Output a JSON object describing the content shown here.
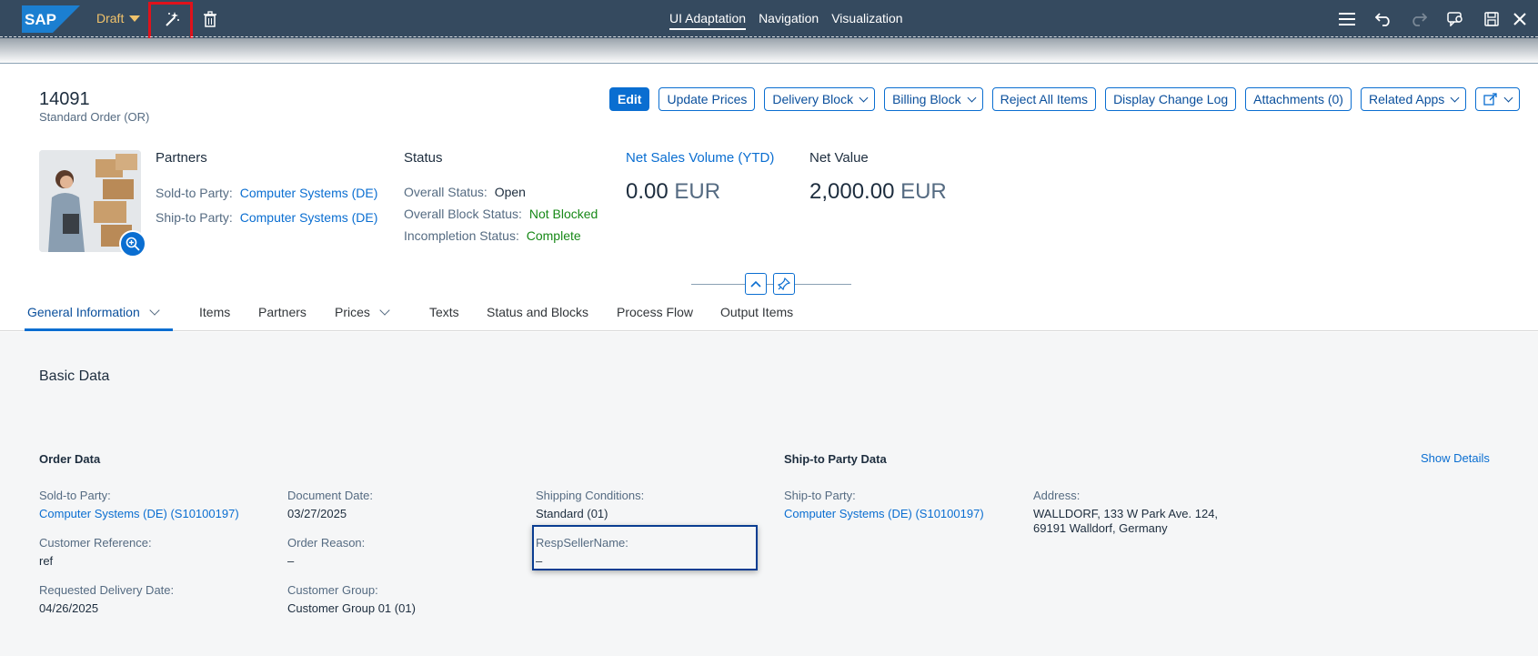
{
  "toolbar": {
    "logo_text": "SAP",
    "draft_label": "Draft",
    "nav_tabs": [
      "UI Adaptation",
      "Navigation",
      "Visualization"
    ],
    "icons": [
      "magic-wand-icon",
      "trash-icon",
      "menu-icon",
      "undo-icon",
      "redo-icon",
      "feedback-icon",
      "save-icon",
      "close-icon"
    ]
  },
  "header": {
    "title": "14091",
    "subtitle": "Standard Order (OR)",
    "actions": {
      "edit": "Edit",
      "update_prices": "Update Prices",
      "delivery_block": "Delivery Block",
      "billing_block": "Billing Block",
      "reject_all": "Reject All Items",
      "change_log": "Display Change Log",
      "attachments": "Attachments (0)",
      "related_apps": "Related Apps"
    },
    "partners": {
      "title": "Partners",
      "sold_to_label": "Sold-to Party:",
      "sold_to_value": "Computer Systems (DE)",
      "ship_to_label": "Ship-to Party:",
      "ship_to_value": "Computer Systems (DE)"
    },
    "status": {
      "title": "Status",
      "overall_label": "Overall Status:",
      "overall_value": "Open",
      "block_label": "Overall Block Status:",
      "block_value": "Not Blocked",
      "incompletion_label": "Incompletion Status:",
      "incompletion_value": "Complete"
    },
    "kpis": {
      "net_sales_title": "Net Sales Volume (YTD)",
      "net_sales_value": "0.00",
      "net_sales_unit": "EUR",
      "net_value_title": "Net Value",
      "net_value_value": "2,000.00",
      "net_value_unit": "EUR"
    }
  },
  "tabs": [
    {
      "label": "General Information"
    },
    {
      "label": "Items"
    },
    {
      "label": "Partners"
    },
    {
      "label": "Prices"
    },
    {
      "label": "Texts"
    },
    {
      "label": "Status and Blocks"
    },
    {
      "label": "Process Flow"
    },
    {
      "label": "Output Items"
    }
  ],
  "content": {
    "section_title": "Basic Data",
    "order_data": {
      "title": "Order Data",
      "sold_to_label": "Sold-to Party:",
      "sold_to_value": "Computer Systems (DE) (S10100197)",
      "customer_ref_label": "Customer Reference:",
      "customer_ref_value": "ref",
      "req_delivery_label": "Requested Delivery Date:",
      "req_delivery_value": "04/26/2025",
      "doc_date_label": "Document Date:",
      "doc_date_value": "03/27/2025",
      "order_reason_label": "Order Reason:",
      "order_reason_value": "–",
      "customer_group_label": "Customer Group:",
      "customer_group_value": "Customer Group 01 (01)",
      "shipping_label": "Shipping Conditions:",
      "shipping_value": "Standard (01)",
      "resp_seller_label": "RespSellerName:",
      "resp_seller_value": "–"
    },
    "ship_to_data": {
      "title": "Ship-to Party Data",
      "show_details": "Show Details",
      "ship_to_label": "Ship-to Party:",
      "ship_to_value": "Computer Systems (DE) (S10100197)",
      "address_label": "Address:",
      "address_line1": "WALLDORF, 133 W Park Ave. 124,",
      "address_line2": "69191 Walldorf, Germany"
    }
  }
}
